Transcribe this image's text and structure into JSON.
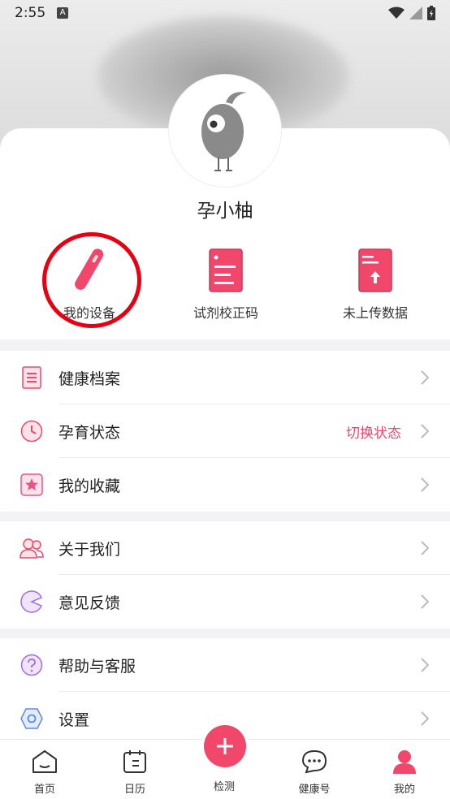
{
  "status_bar": {
    "time": "2:55",
    "badge": "A"
  },
  "profile": {
    "username": "孕小柚"
  },
  "quick_actions": [
    {
      "label": "我的设备",
      "icon": "device-stick-icon"
    },
    {
      "label": "试剂校正码",
      "icon": "document-icon"
    },
    {
      "label": "未上传数据",
      "icon": "upload-book-icon"
    }
  ],
  "menu_group_1": [
    {
      "label": "健康档案",
      "icon": "record-icon"
    },
    {
      "label": "孕育状态",
      "icon": "clock-icon",
      "extra": "切换状态"
    },
    {
      "label": "我的收藏",
      "icon": "star-icon"
    }
  ],
  "menu_group_2": [
    {
      "label": "关于我们",
      "icon": "users-icon"
    },
    {
      "label": "意见反馈",
      "icon": "feedback-icon"
    }
  ],
  "menu_group_3": [
    {
      "label": "帮助与客服",
      "icon": "help-icon"
    },
    {
      "label": "设置",
      "icon": "settings-icon"
    }
  ],
  "tabs": [
    {
      "label": "首页",
      "icon": "home-icon"
    },
    {
      "label": "日历",
      "icon": "calendar-icon"
    },
    {
      "label": "检测",
      "icon": "plus-icon"
    },
    {
      "label": "健康号",
      "icon": "chat-icon"
    },
    {
      "label": "我的",
      "icon": "profile-icon",
      "active": true
    }
  ],
  "colors": {
    "accent": "#f0476b",
    "highlight": "#e60012"
  }
}
